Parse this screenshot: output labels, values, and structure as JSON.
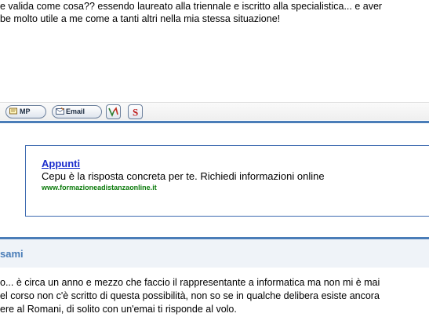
{
  "post": {
    "lines": [
      "e valida come cosa?? essendo laureato alla triennale e iscritto alla specialistica... e aver",
      "be molto utile a me come a tanti altri nella mia stessa situazione!"
    ]
  },
  "toolbar": {
    "mp_label": "MP",
    "email_label": "Email"
  },
  "ad": {
    "title": "Appunti",
    "description": "Cepu è la risposta concreta per te. Richiedi informazioni online",
    "url": "www.formazioneadistanzaonline.it"
  },
  "reply": {
    "title": "sami",
    "lines": [
      "o... è circa un anno e mezzo che faccio il rappresentante a informatica ma non mi è mai",
      "el corso non c'è scritto di questa possibilità, non so se in qualche delibera esiste ancora",
      "ere al Romani, di solito con un'emai ti risponde al volo."
    ]
  },
  "colors": {
    "accent": "#4a7db8",
    "ad_link": "#1a2ccc",
    "ad_url": "#0a7a0a"
  }
}
